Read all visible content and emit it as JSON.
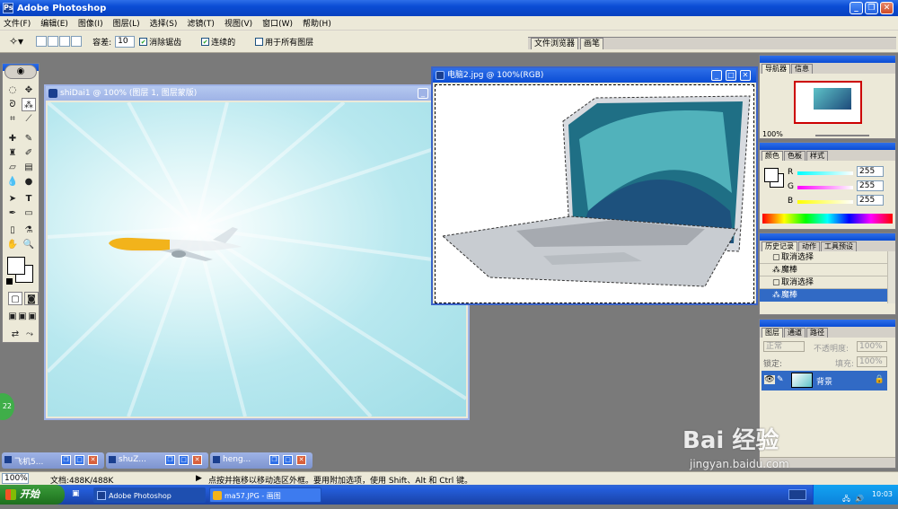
{
  "app": {
    "title": "Adobe Photoshop"
  },
  "menu": [
    "文件(F)",
    "编辑(E)",
    "图像(I)",
    "图层(L)",
    "选择(S)",
    "滤镜(T)",
    "视图(V)",
    "窗口(W)",
    "帮助(H)"
  ],
  "options": {
    "tolerance_label": "容差:",
    "tolerance_value": "10",
    "antialias": "消除锯齿",
    "contiguous": "连续的",
    "all_layers": "用于所有图层",
    "tabs": [
      "文件浏览器",
      "画笔"
    ]
  },
  "doc1": {
    "title": "shiDai1 @ 100% (图层 1, 图层蒙版)"
  },
  "doc2": {
    "title": "电脑2.jpg @ 100%(RGB)"
  },
  "navigator": {
    "tabs": [
      "导航器",
      "信息"
    ],
    "zoom": "100%"
  },
  "color": {
    "tabs": [
      "颜色",
      "色板",
      "样式"
    ],
    "r_label": "R",
    "g_label": "G",
    "b_label": "B",
    "r_value": "255",
    "g_value": "255",
    "b_value": "255"
  },
  "history": {
    "tabs": [
      "历史记录",
      "动作",
      "工具预设"
    ],
    "items": [
      "取消选择",
      "魔棒",
      "取消选择",
      "魔棒"
    ]
  },
  "layers": {
    "tabs": [
      "图层",
      "通道",
      "路径"
    ],
    "blend": "正常",
    "opacity_label": "不透明度:",
    "opacity_value": "100%",
    "lock_label": "锁定:",
    "fill_label": "填充:",
    "fill_value": "100%",
    "layer_name": "背景"
  },
  "minimized": [
    "飞机5...",
    "shuZ...",
    "heng..."
  ],
  "status": {
    "zoom": "100%",
    "doc_label": "文档:488K/488K",
    "hint": "点按并拖移以移动选区外框。要用附加选项，使用 Shift、Alt 和 Ctrl 键。"
  },
  "taskbar": {
    "start": "开始",
    "items": [
      "Adobe Photoshop",
      "ma57.JPG - 画图"
    ],
    "time": "10:03"
  },
  "watermark": {
    "logo": "Bai 经验",
    "url": "jingyan.baidu.com"
  },
  "badge": "22"
}
